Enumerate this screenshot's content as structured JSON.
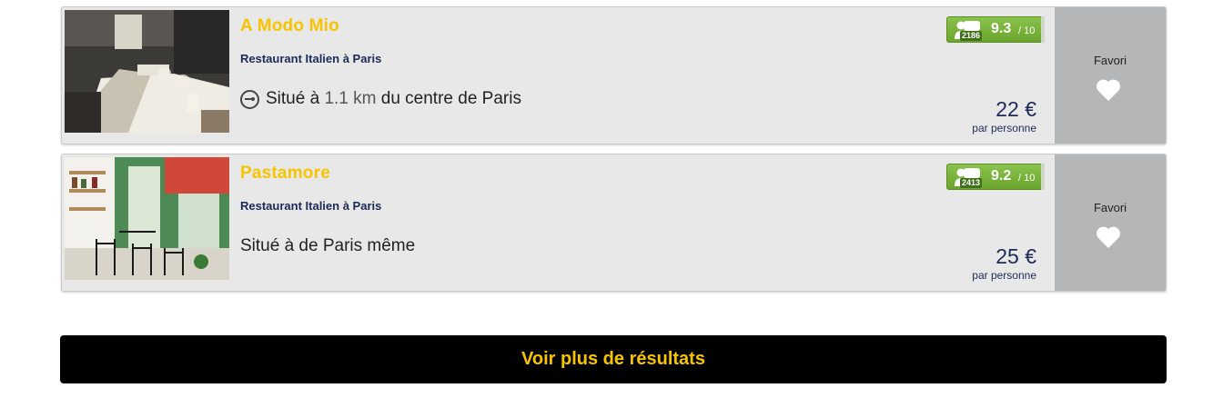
{
  "results": [
    {
      "name": "A Modo Mio",
      "category": "Restaurant Italien à Paris",
      "location_prefix": "Situé à",
      "distance": "1.1 km",
      "location_suffix": "du centre de Paris",
      "reviews_count": "2186",
      "score": "9.3",
      "score_max": "/ 10",
      "price": "22 €",
      "price_note": "par personne",
      "favorite_label": "Favori",
      "photo": "restaurant-interior-tables-photo"
    },
    {
      "name": "Pastamore",
      "category": "Restaurant Italien à Paris",
      "location_text": "Situé à de Paris même",
      "reviews_count": "2413",
      "score": "9.2",
      "score_max": "/ 10",
      "price": "25 €",
      "price_note": "par personne",
      "favorite_label": "Favori",
      "photo": "restaurant-terrace-chairs-photo"
    }
  ],
  "more_button_label": "Voir plus de résultats",
  "icons": {
    "location": "compass-icon",
    "rating": "people-rating-icon",
    "favorite": "heart-icon"
  },
  "colors": {
    "accent": "#f6c400",
    "navy": "#1d2a56",
    "rating_green": "#7ab43d",
    "favorite_panel": "#b5b6b8"
  }
}
